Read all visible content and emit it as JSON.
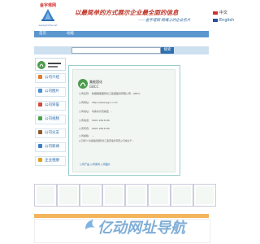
{
  "header": {
    "logo_top": "金字塔网",
    "logo_bottom": "www.jinzita.net",
    "slogan": "以最简单的方式展示企业最全面的信息",
    "sub_slogan": "——金字塔网  网络上的企业名片",
    "lang_cn": "中文",
    "lang_en": "English"
  },
  "nav": {
    "left": "首页",
    "right": "动能"
  },
  "search": {
    "placeholder": "",
    "button": "搜索"
  },
  "sidebar": {
    "items": [
      {
        "label": "公司介绍"
      },
      {
        "label": "公司图片"
      },
      {
        "label": "公司荣誉"
      },
      {
        "label": "公司视频"
      },
      {
        "label": "公司分支"
      },
      {
        "label": "公司新闻"
      },
      {
        "label": "企业相册"
      }
    ]
  },
  "card": {
    "company_short": "美能国化",
    "company_en": "GBCC",
    "rows": [
      {
        "k": "公司名称:",
        "v": "新疆美能国际化工集团股份有限公司 - QBCC"
      },
      {
        "k": "公司网址:",
        "v": "http://www.qgcc.com"
      },
      {
        "k": "公司地址:",
        "v": "乌鲁木齐高新区 ..."
      },
      {
        "k": "公司电话:",
        "v": "0997-2813130"
      },
      {
        "k": "公司传真:",
        "v": "0997-2813130"
      },
      {
        "k": "公司邮箱:",
        "v": "..."
      }
    ],
    "intro": "公司简介:新疆美能国际化工集团股份有限公司成立于...",
    "links": "公司产品   公司荣誉   公司图片"
  },
  "watermark": "亿动网址导航",
  "colors": {
    "nav": "#5b96cf",
    "search_bg": "#cde0f0",
    "button": "#2d6fb0",
    "bottom_bar": "#f3b55b"
  }
}
